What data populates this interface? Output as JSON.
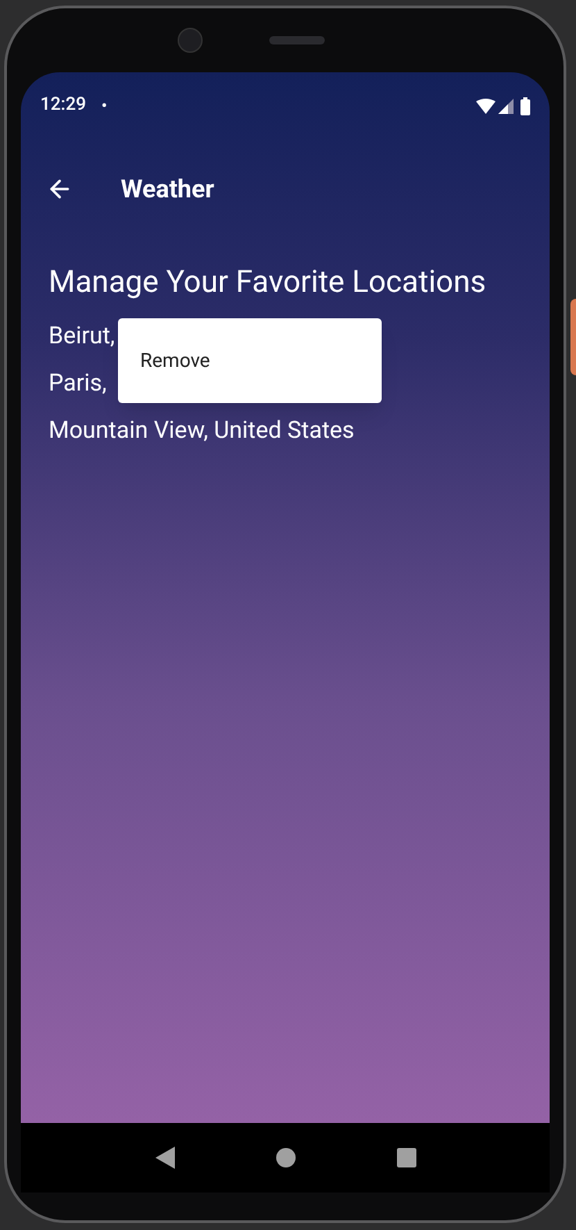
{
  "status_bar": {
    "time": "12:29",
    "notification_dot": "•"
  },
  "toolbar": {
    "title": "Weather"
  },
  "heading": "Manage Your Favorite Locations",
  "locations": [
    {
      "name": "Beirut,"
    },
    {
      "name": "Paris,"
    },
    {
      "name": "Mountain View, United States"
    }
  ],
  "context_menu": {
    "items": [
      "Remove"
    ]
  }
}
